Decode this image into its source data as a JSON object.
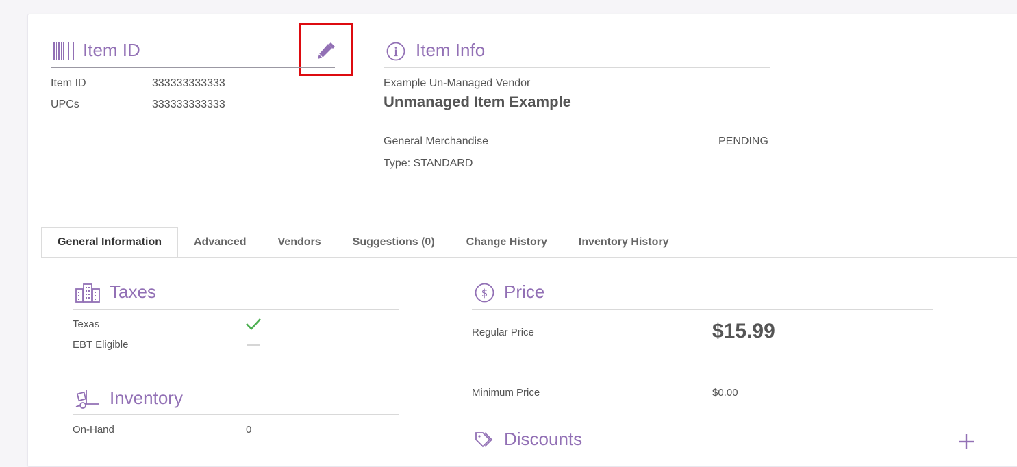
{
  "colors": {
    "accent": "#9270b5",
    "check": "#4caf50",
    "highlight": "#dd0b10"
  },
  "item_id_section": {
    "title": "Item ID",
    "icon": "barcode-icon",
    "edit_icon": "pencil-icon",
    "rows": [
      {
        "label": "Item ID",
        "value": "333333333333"
      },
      {
        "label": "UPCs",
        "value": "333333333333"
      }
    ]
  },
  "item_info_section": {
    "title": "Item Info",
    "icon": "info-circle-icon",
    "vendor": "Example Un-Managed Vendor",
    "name": "Unmanaged Item Example",
    "category": "General Merchandise",
    "status": "PENDING",
    "type": "Type: STANDARD"
  },
  "tabs": [
    {
      "label": "General Information",
      "active": true
    },
    {
      "label": "Advanced"
    },
    {
      "label": "Vendors"
    },
    {
      "label": "Suggestions (0)"
    },
    {
      "label": "Change History"
    },
    {
      "label": "Inventory History"
    }
  ],
  "taxes": {
    "title": "Taxes",
    "icon": "buildings-icon",
    "rows": [
      {
        "label": "Texas",
        "state": "check"
      },
      {
        "label": "EBT Eligible",
        "state": "dash"
      }
    ]
  },
  "inventory": {
    "title": "Inventory",
    "icon": "hand-truck-icon",
    "rows": [
      {
        "label": "On-Hand",
        "value": "0"
      }
    ]
  },
  "price": {
    "title": "Price",
    "icon": "dollar-circle-icon",
    "regular_label": "Regular Price",
    "regular_value": "$15.99",
    "minimum_label": "Minimum Price",
    "minimum_value": "$0.00"
  },
  "discounts": {
    "title": "Discounts",
    "icon": "tags-icon",
    "add_icon": "plus-icon"
  }
}
